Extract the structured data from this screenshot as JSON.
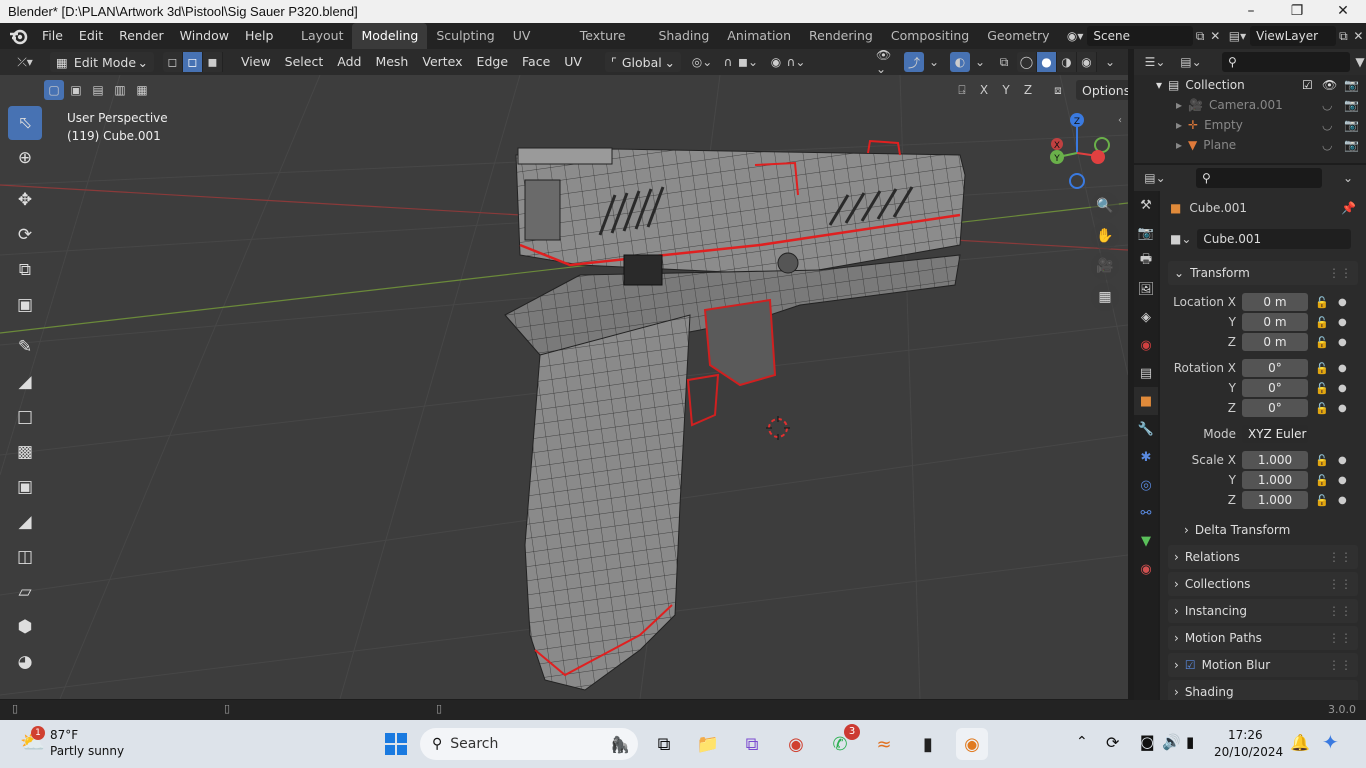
{
  "window": {
    "title": "Blender* [D:\\PLAN\\Artwork 3d\\Pistool\\Sig Sauer P320.blend]"
  },
  "menu": [
    "File",
    "Edit",
    "Render",
    "Window",
    "Help"
  ],
  "workspaces": [
    "Layout",
    "Modeling",
    "Sculpting",
    "UV Editing",
    "Texture Paint",
    "Shading",
    "Animation",
    "Rendering",
    "Compositing",
    "Geometry Nod"
  ],
  "scene": {
    "name": "Scene",
    "view_layer": "ViewLayer"
  },
  "viewport_header": {
    "mode": "Edit Mode",
    "menus": [
      "View",
      "Select",
      "Add",
      "Mesh",
      "Vertex",
      "Edge",
      "Face",
      "UV"
    ],
    "orientation": "Global",
    "axes": [
      "X",
      "Y",
      "Z"
    ],
    "options": "Options"
  },
  "viewport": {
    "perspective": "User Perspective",
    "object": "(119) Cube.001"
  },
  "outliner": {
    "rows": [
      {
        "label": "Collection",
        "icon": "collection-icon"
      },
      {
        "label": "Camera.001",
        "icon": "camera-icon"
      },
      {
        "label": "Empty",
        "icon": "empty-icon"
      },
      {
        "label": "Plane",
        "icon": "mesh-icon"
      }
    ]
  },
  "properties": {
    "object_name": "Cube.001",
    "data_name": "Cube.001",
    "transform_label": "Transform",
    "location": {
      "label": "Location",
      "x": "0 m",
      "y": "0 m",
      "z": "0 m"
    },
    "rotation": {
      "label": "Rotation",
      "x": "0°",
      "y": "0°",
      "z": "0°"
    },
    "mode": {
      "label": "Mode",
      "value": "XYZ Euler"
    },
    "scale": {
      "label": "Scale",
      "x": "1.000",
      "y": "1.000",
      "z": "1.000"
    },
    "axis_labels": {
      "x": "X",
      "y": "Y",
      "z": "Z"
    },
    "panels": [
      "Delta Transform",
      "Relations",
      "Collections",
      "Instancing",
      "Motion Paths",
      "Motion Blur",
      "Shading"
    ]
  },
  "status": {
    "version": "3.0.0"
  },
  "taskbar": {
    "weather_temp": "87°F",
    "weather_desc": "Partly sunny",
    "weather_badge": "1",
    "search": "Search",
    "whatsapp_badge": "3",
    "time": "17:26",
    "date": "20/10/2024"
  },
  "colors": {
    "accent": "#4772b3",
    "edge_seam": "#e02020",
    "viewport_bg": "#3d3d3d"
  }
}
